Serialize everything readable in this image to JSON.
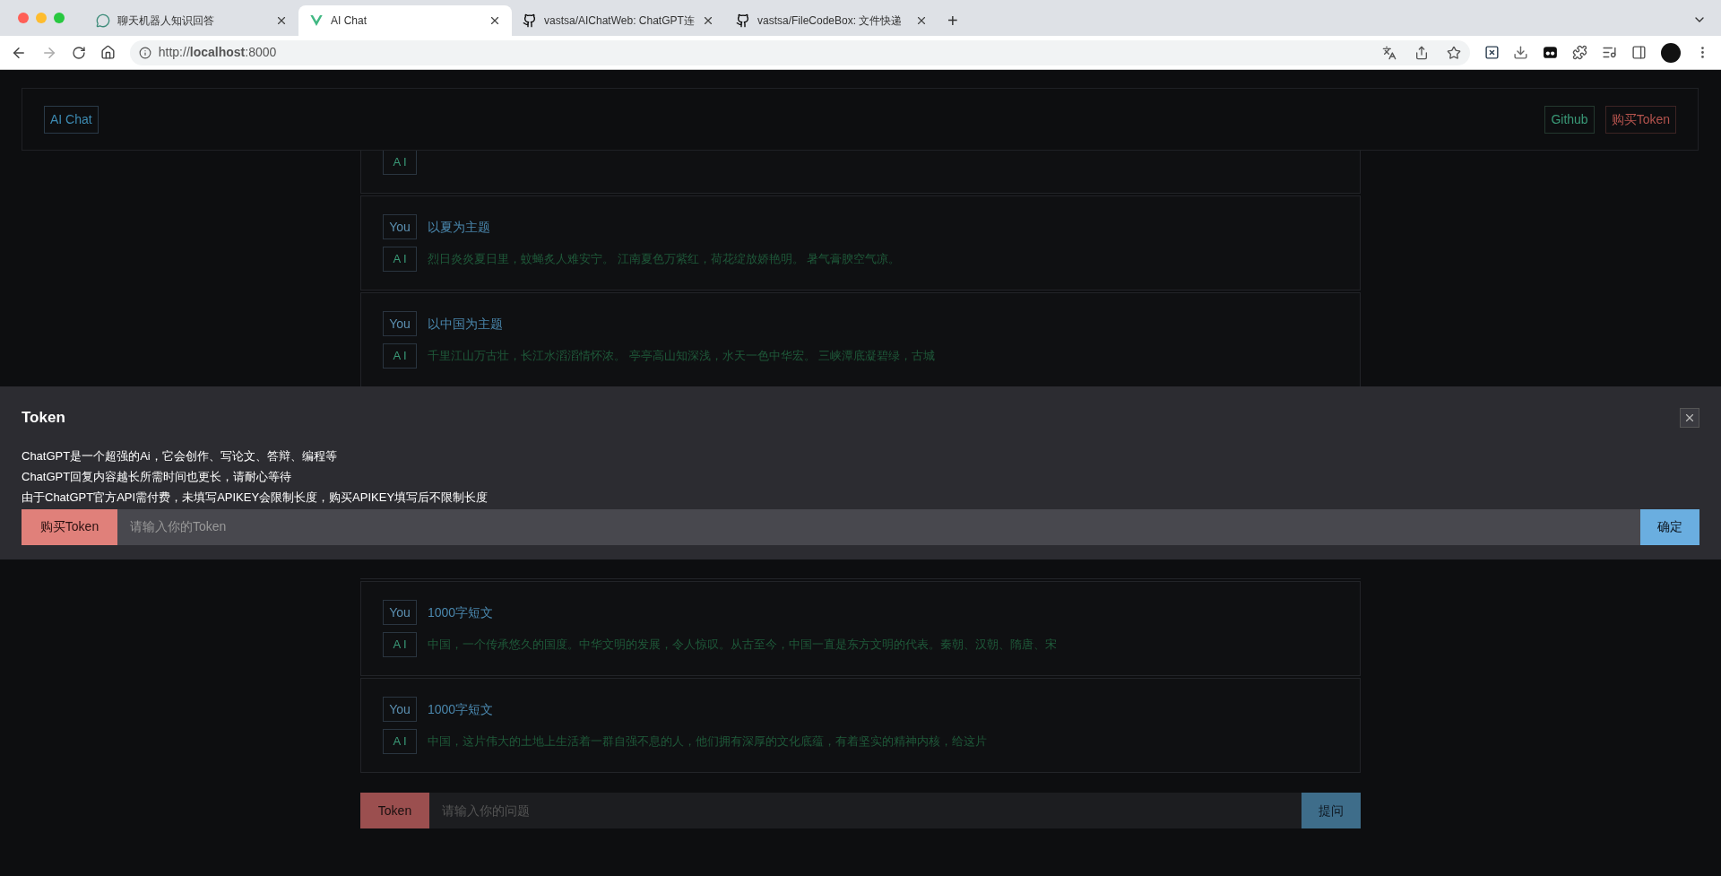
{
  "browser": {
    "tabs": [
      {
        "title": "聊天机器人知识回答",
        "selected": false,
        "kind": "chatgpt"
      },
      {
        "title": "AI Chat",
        "selected": true,
        "kind": "vue"
      },
      {
        "title": "vastsa/AIChatWeb: ChatGPT连",
        "selected": false,
        "kind": "github"
      },
      {
        "title": "vastsa/FileCodeBox: 文件快递",
        "selected": false,
        "kind": "github"
      }
    ],
    "new_tab": "+",
    "url": "http://**localhost**:8000"
  },
  "header": {
    "brand": "AI Chat",
    "github": "Github",
    "buy": "购买Token"
  },
  "messages_top": [
    {
      "ai": "A I"
    },
    {
      "you": "You",
      "question": "以夏为主题",
      "ai": "A I",
      "answer": "烈日炎炎夏日里，蚊蝇炙人难安宁。 江南夏色万紫红，荷花绽放娇艳明。 暑气膏腴空气凉。"
    },
    {
      "you": "You",
      "question": "以中国为主题",
      "ai": "A I",
      "answer": "千里江山万古壮，长江水滔滔情怀浓。 亭亭高山知深浅，水天一色中华宏。 三峡潭底凝碧绿，古城"
    }
  ],
  "messages_bottom": [
    {
      "you": "You",
      "question": "1000字短文",
      "ai": "A I",
      "answer": "中国，一个传承悠久的国度。中华文明的发展，令人惊叹。从古至今，中国一直是东方文明的代表。秦朝、汉朝、隋唐、宋"
    },
    {
      "you": "You",
      "question": "1000字短文",
      "ai": "A I",
      "answer": "中国，这片伟大的土地上生活着一群自强不息的人，他们拥有深厚的文化底蕴，有着坚实的精神内核，给这片"
    }
  ],
  "composer": {
    "token_button": "Token",
    "placeholder": "请输入你的问题",
    "ask_button": "提问"
  },
  "modal": {
    "title": "Token",
    "lines": [
      "ChatGPT是一个超强的Ai，它会创作、写论文、答辩、编程等",
      "ChatGPT回复内容越长所需时间也更长，请耐心等待",
      "由于ChatGPT官方API需付费，未填写APIKEY会限制长度，购买APIKEY填写后不限制长度"
    ],
    "buy_button": "购买Token",
    "placeholder": "请输入你的Token",
    "confirm_button": "确定"
  }
}
